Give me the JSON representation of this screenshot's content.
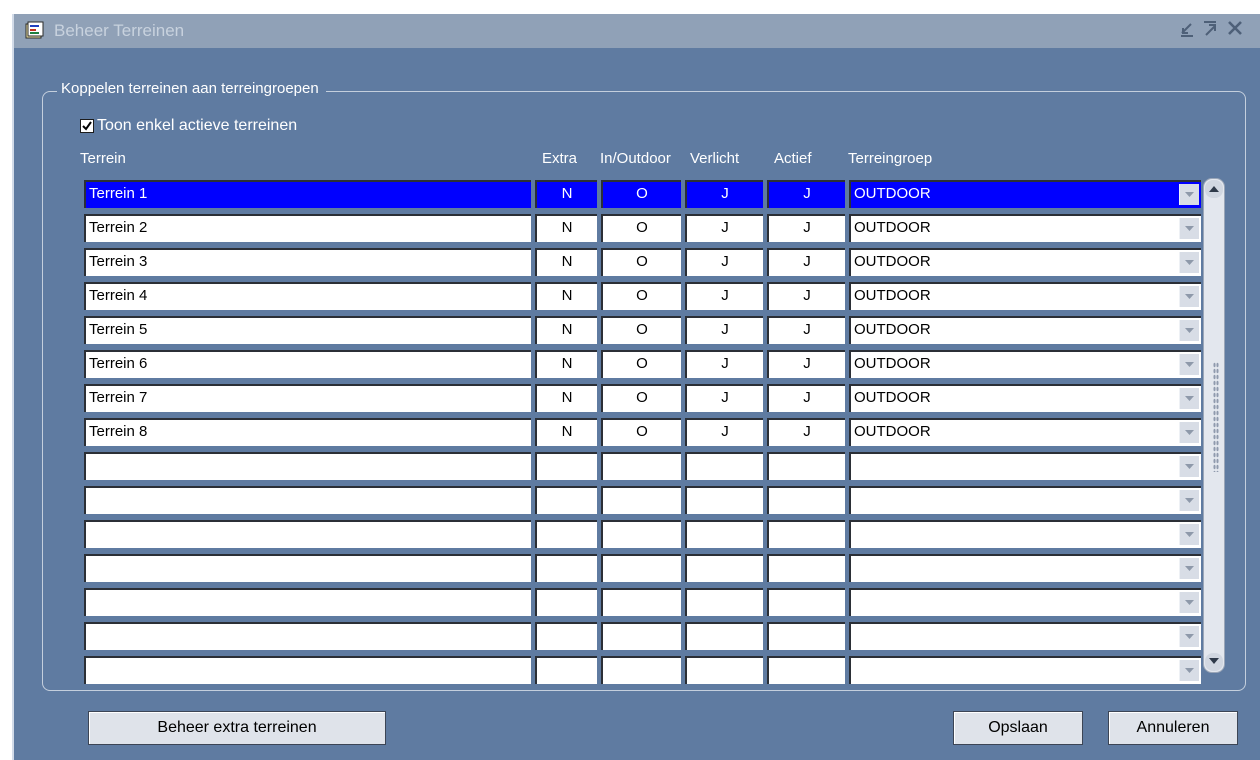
{
  "window": {
    "title": "Beheer Terreinen",
    "icon": "form-icon",
    "controls": [
      "minimize-icon",
      "maximize-icon",
      "close-icon"
    ]
  },
  "group": {
    "legend": "Koppelen terreinen aan terreingroepen"
  },
  "filter": {
    "label": "Toon enkel actieve terreinen",
    "checked": true
  },
  "table": {
    "headers": {
      "terrein": "Terrein",
      "extra": "Extra",
      "inoutdoor": "In/Outdoor",
      "verlicht": "Verlicht",
      "actief": "Actief",
      "terreingroep": "Terreingroep"
    },
    "rows": [
      {
        "terrein": "Terrein 1",
        "extra": "N",
        "inoutdoor": "O",
        "verlicht": "J",
        "actief": "J",
        "terreingroep": "OUTDOOR"
      },
      {
        "terrein": "Terrein 2",
        "extra": "N",
        "inoutdoor": "O",
        "verlicht": "J",
        "actief": "J",
        "terreingroep": "OUTDOOR"
      },
      {
        "terrein": "Terrein 3",
        "extra": "N",
        "inoutdoor": "O",
        "verlicht": "J",
        "actief": "J",
        "terreingroep": "OUTDOOR"
      },
      {
        "terrein": "Terrein 4",
        "extra": "N",
        "inoutdoor": "O",
        "verlicht": "J",
        "actief": "J",
        "terreingroep": "OUTDOOR"
      },
      {
        "terrein": "Terrein 5",
        "extra": "N",
        "inoutdoor": "O",
        "verlicht": "J",
        "actief": "J",
        "terreingroep": "OUTDOOR"
      },
      {
        "terrein": "Terrein 6",
        "extra": "N",
        "inoutdoor": "O",
        "verlicht": "J",
        "actief": "J",
        "terreingroep": "OUTDOOR"
      },
      {
        "terrein": "Terrein 7",
        "extra": "N",
        "inoutdoor": "O",
        "verlicht": "J",
        "actief": "J",
        "terreingroep": "OUTDOOR"
      },
      {
        "terrein": "Terrein 8",
        "extra": "N",
        "inoutdoor": "O",
        "verlicht": "J",
        "actief": "J",
        "terreingroep": "OUTDOOR"
      },
      {
        "terrein": "",
        "extra": "",
        "inoutdoor": "",
        "verlicht": "",
        "actief": "",
        "terreingroep": ""
      },
      {
        "terrein": "",
        "extra": "",
        "inoutdoor": "",
        "verlicht": "",
        "actief": "",
        "terreingroep": ""
      },
      {
        "terrein": "",
        "extra": "",
        "inoutdoor": "",
        "verlicht": "",
        "actief": "",
        "terreingroep": ""
      },
      {
        "terrein": "",
        "extra": "",
        "inoutdoor": "",
        "verlicht": "",
        "actief": "",
        "terreingroep": ""
      },
      {
        "terrein": "",
        "extra": "",
        "inoutdoor": "",
        "verlicht": "",
        "actief": "",
        "terreingroep": ""
      },
      {
        "terrein": "",
        "extra": "",
        "inoutdoor": "",
        "verlicht": "",
        "actief": "",
        "terreingroep": ""
      },
      {
        "terrein": "",
        "extra": "",
        "inoutdoor": "",
        "verlicht": "",
        "actief": "",
        "terreingroep": ""
      }
    ],
    "selected_row": 1
  },
  "buttons": {
    "manage": "Beheer extra terreinen",
    "save": "Opslaan",
    "cancel": "Annuleren"
  },
  "colors": {
    "window_bg": "#5f7ba1",
    "titlebar_bg": "#90a1b7",
    "selection": "#0000ff"
  }
}
